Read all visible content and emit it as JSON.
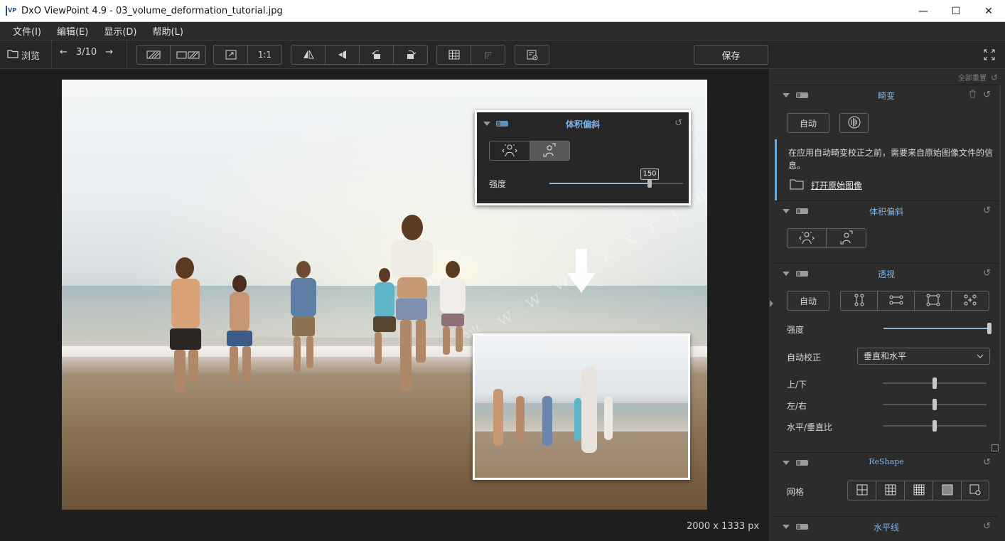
{
  "window": {
    "app_logo": "VP",
    "title": "DxO ViewPoint 4.9 - 03_volume_deformation_tutorial.jpg",
    "minimize": "—",
    "maximize": "☐",
    "close": "✕"
  },
  "menu": {
    "file": "文件(I)",
    "edit": "编辑(E)",
    "view": "显示(D)",
    "help": "帮助(L)"
  },
  "toolbar": {
    "browse_label": "浏览",
    "prev": "←",
    "counter": "3/10",
    "next": "→",
    "zoom_one_to_one": "1:1",
    "save_label": "保存"
  },
  "overlay": {
    "title": "体积偏斜",
    "strength_label": "强度",
    "strength_value": "150",
    "strength_fraction": 0.75,
    "watermark": "迷 w w w . x x r j m . c o m"
  },
  "canvas": {
    "dimensions": "2000 x 1333 px"
  },
  "panel": {
    "reset_all": "全部重置",
    "distortion": {
      "title": "畸变",
      "auto_label": "自动",
      "info_text": "在应用自动畸变校正之前，需要来自原始图像文件的信息。",
      "open_raw_label": "打开原始图像"
    },
    "volume": {
      "title": "体积偏斜"
    },
    "perspective": {
      "title": "透视",
      "auto_label": "自动",
      "strength_label": "强度",
      "strength_fraction": 1.0,
      "auto_correct_label": "自动校正",
      "auto_correct_value": "垂直和水平",
      "up_down_label": "上/下",
      "up_down_fraction": 0.5,
      "left_right_label": "左/右",
      "left_right_fraction": 0.5,
      "ratio_label": "水平/垂直比",
      "ratio_fraction": 0.5
    },
    "reshape": {
      "title": "ReShape",
      "grid_label": "网格"
    },
    "horizon": {
      "title": "水平线"
    }
  },
  "colors": {
    "accent": "#7fb3e6",
    "panel_bg": "#2c2c2c",
    "canvas_bg": "#1e1e1e"
  }
}
